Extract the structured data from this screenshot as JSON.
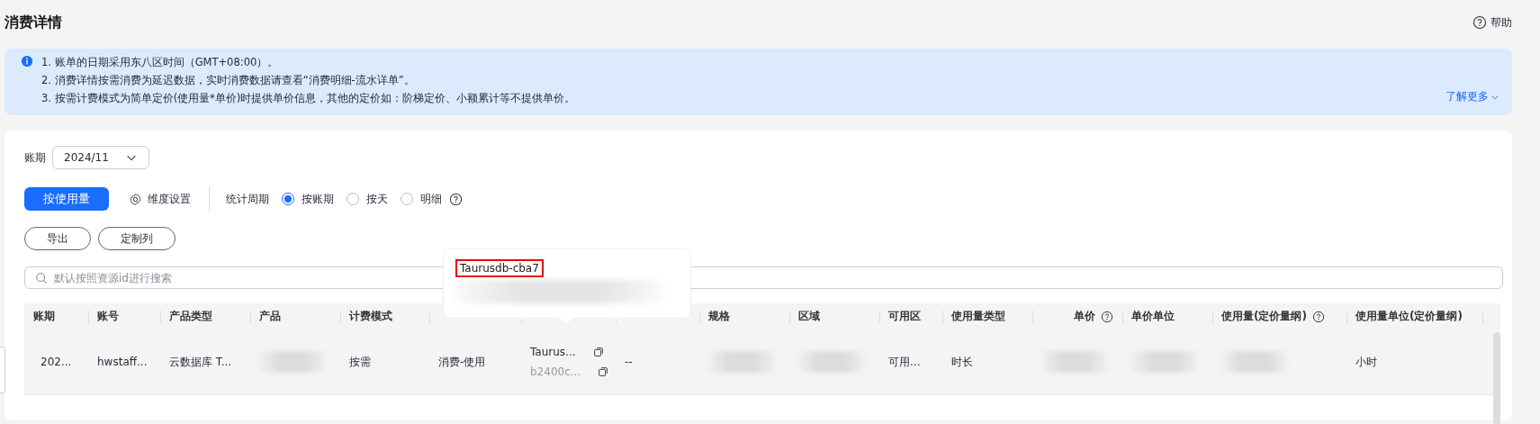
{
  "page": {
    "title": "消费详情",
    "help": "帮助"
  },
  "notice": {
    "lines": [
      "1. 账单的日期采用东八区时间（GMT+08:00）。",
      "2. 消费详情按需消费为延迟数据，实时消费数据请查看“消费明细-流水详单”。",
      "3. 按需计费模式为简单定价(使用量*单价)时提供单价信息，其他的定价如：阶梯定价、小额累计等不提供单价。"
    ],
    "more_link": "了解更多"
  },
  "filters": {
    "period_label": "账期",
    "period_value": "2024/11"
  },
  "view_buttons": [
    {
      "label": "按使用量",
      "selected": true
    }
  ],
  "dimension_settings": "维度设置",
  "stat_period": {
    "label": "统计周期",
    "options": [
      {
        "label": "按账期",
        "selected": true
      },
      {
        "label": "按天",
        "selected": false
      },
      {
        "label": "明细",
        "selected": false
      }
    ]
  },
  "actions": [
    "导出",
    "定制列"
  ],
  "search": {
    "placeholder": "默认按照资源id进行搜索"
  },
  "table": {
    "columns": [
      {
        "label": "账期"
      },
      {
        "label": "账号"
      },
      {
        "label": "产品类型"
      },
      {
        "label": "产品"
      },
      {
        "label": "计费模式"
      },
      {},
      {},
      {},
      {
        "label": "规格"
      },
      {
        "label": "区域"
      },
      {
        "label": "可用区"
      },
      {
        "label": "使用量类型"
      },
      {
        "label": "单价",
        "help": true
      },
      {
        "label": "单价单位"
      },
      {
        "label": "使用量(定价量纲)",
        "help": true
      },
      {
        "label": "使用量单位(定价量纲)"
      }
    ],
    "rows": [
      {
        "cells": [
          {
            "kind": "text",
            "text": "202..."
          },
          {
            "kind": "text",
            "text": "hwstaff..."
          },
          {
            "kind": "text",
            "text": "云数据库 T..."
          },
          {
            "kind": "blurred"
          },
          {
            "kind": "text",
            "text": "按需"
          },
          {
            "kind": "text",
            "text": "消费-使用"
          },
          {
            "kind": "resource",
            "name": "Taurus...",
            "id": "b2400c..."
          },
          {
            "kind": "text",
            "text": "--"
          },
          {
            "kind": "blurred"
          },
          {
            "kind": "blurred"
          },
          {
            "kind": "text",
            "text": "可用..."
          },
          {
            "kind": "text",
            "text": "时长"
          },
          {
            "kind": "blurred"
          },
          {
            "kind": "blurred"
          },
          {
            "kind": "blurred"
          },
          {
            "kind": "text",
            "text": "小时"
          }
        ]
      }
    ]
  },
  "popover": {
    "title": "Taurusdb-cba7",
    "highlighted": true
  }
}
